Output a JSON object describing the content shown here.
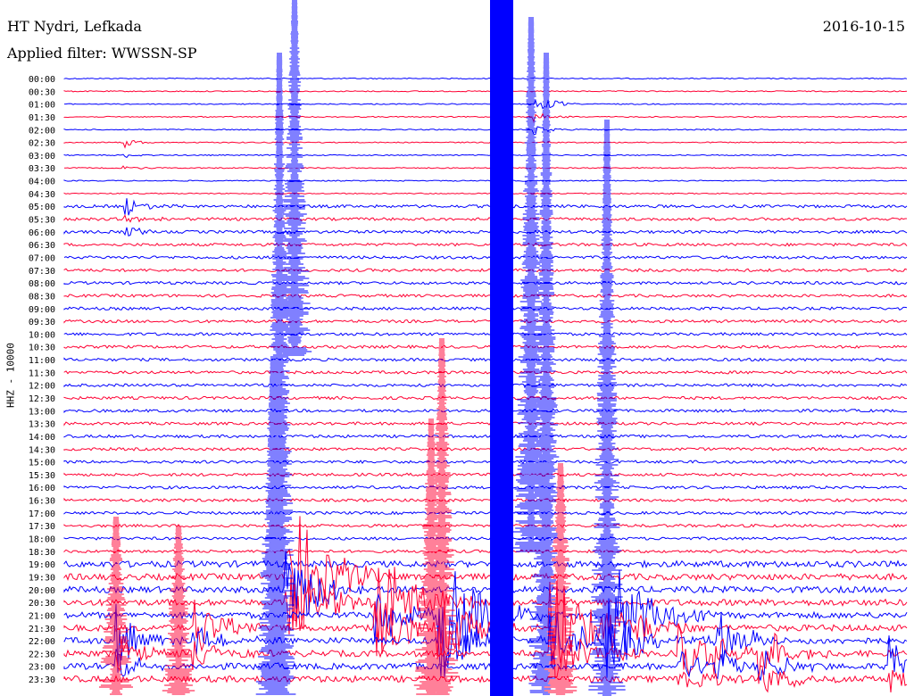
{
  "header": {
    "station": "HT Nydri, Lefkada",
    "filter": "Applied filter: WWSSN-SP",
    "date": "2016-10-15"
  },
  "chart_data": {
    "type": "line",
    "title": "HT Nydri, Lefkada",
    "ylabel": "HHZ - 10000",
    "colors": {
      "odd": "#0000ff",
      "even": "#ff0033"
    },
    "rows": [
      "00:00",
      "00:30",
      "01:00",
      "01:30",
      "02:00",
      "02:30",
      "03:00",
      "03:30",
      "04:00",
      "04:30",
      "05:00",
      "05:30",
      "06:00",
      "06:30",
      "07:00",
      "07:30",
      "08:00",
      "08:30",
      "09:00",
      "09:30",
      "10:00",
      "10:30",
      "11:00",
      "11:30",
      "12:00",
      "12:30",
      "13:00",
      "13:30",
      "14:00",
      "14:30",
      "15:00",
      "15:30",
      "16:00",
      "16:30",
      "17:00",
      "17:30",
      "18:00",
      "18:30",
      "19:00",
      "19:30",
      "20:00",
      "20:30",
      "21:00",
      "21:30",
      "22:00",
      "22:30",
      "23:00",
      "23:30"
    ]
  }
}
